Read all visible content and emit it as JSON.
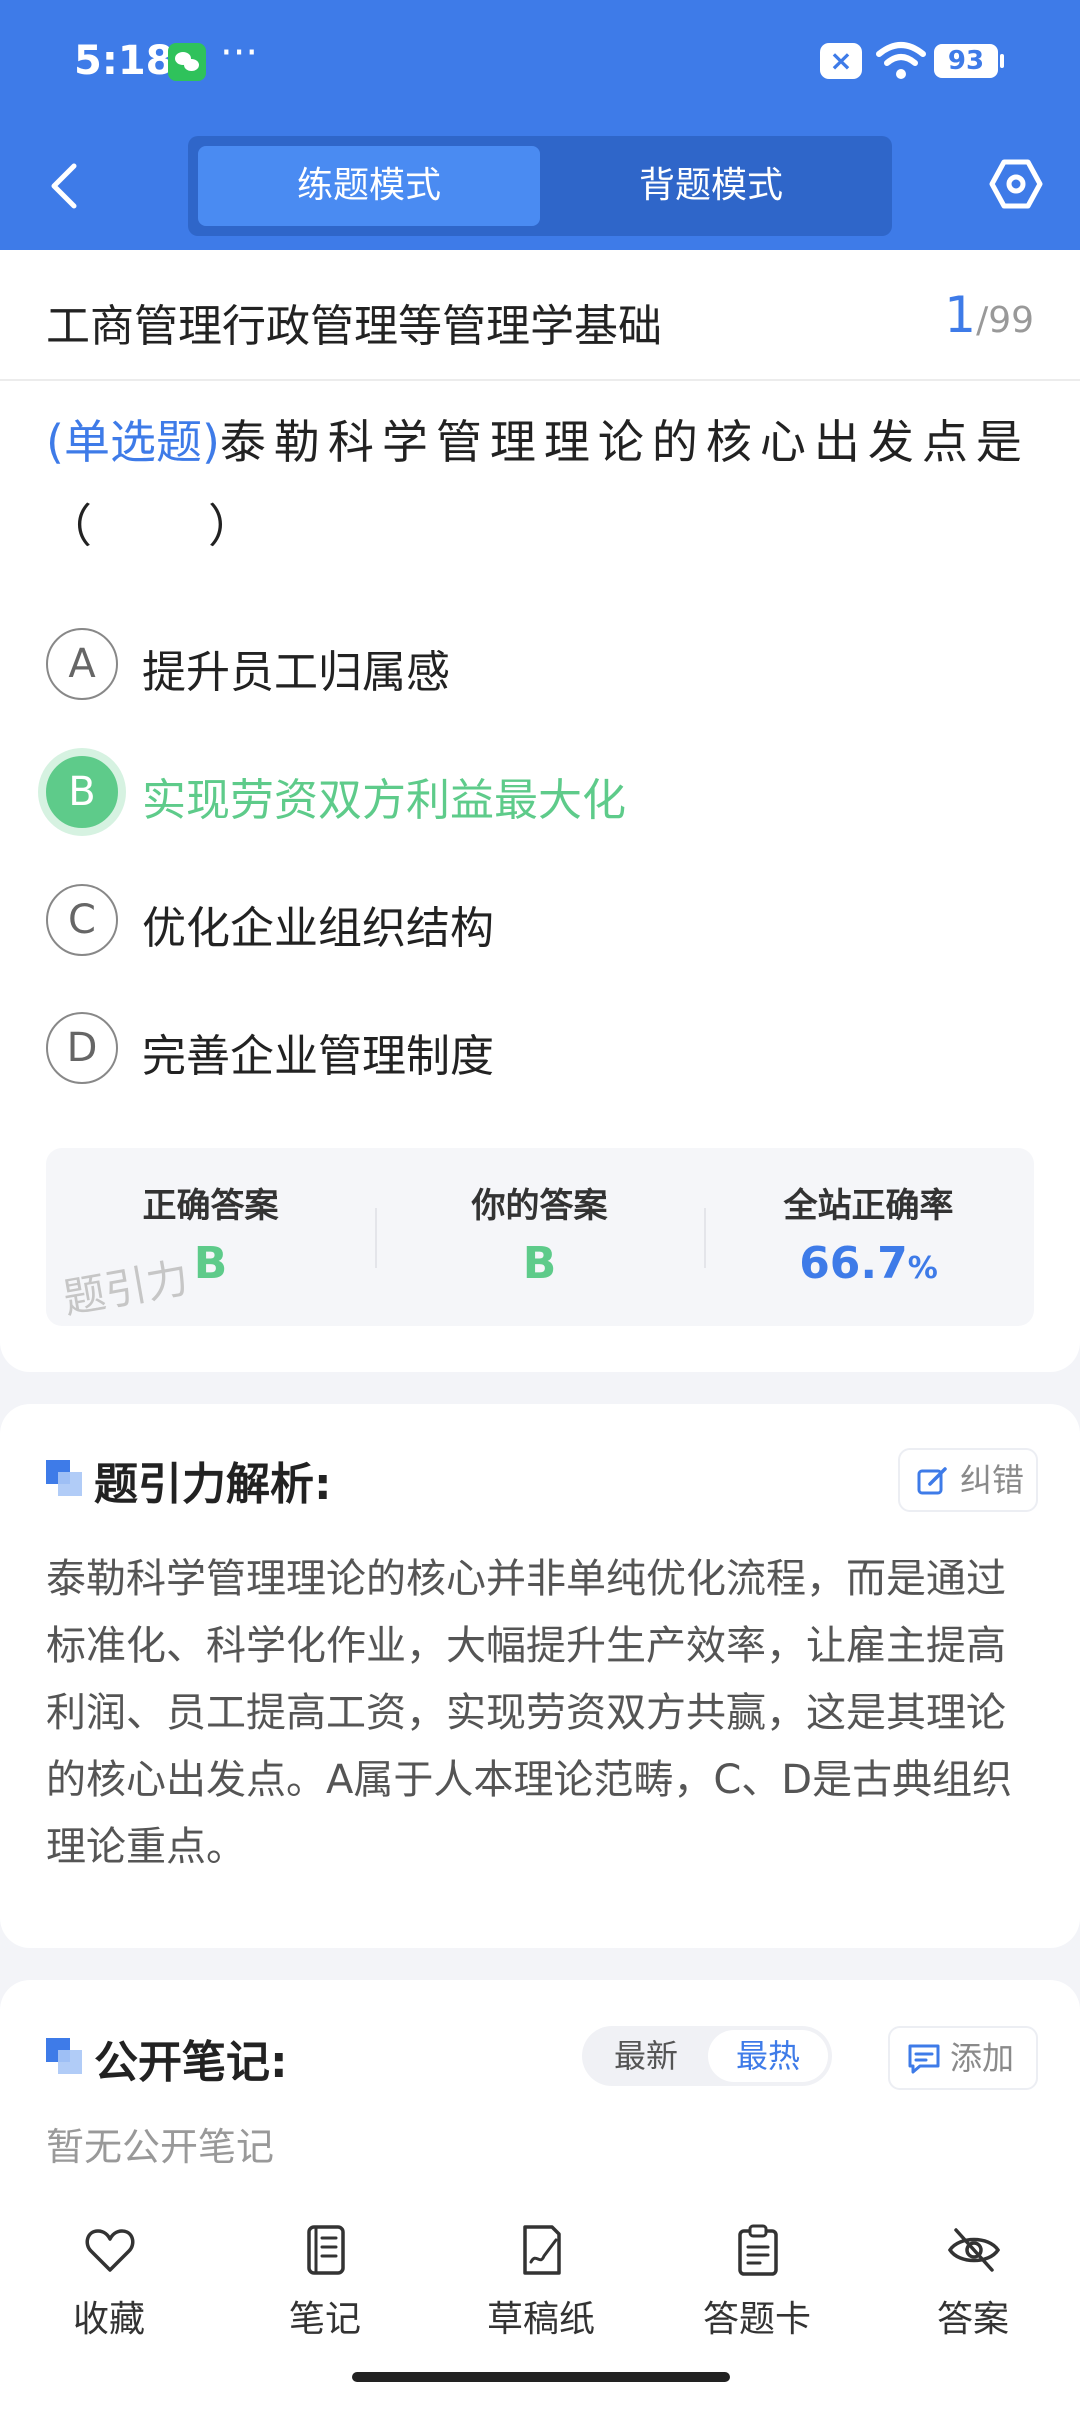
{
  "status_bar": {
    "time": "5:18",
    "dots": "···",
    "battery": "93"
  },
  "header": {
    "tabs": [
      {
        "label": "练题模式",
        "active": true
      },
      {
        "label": "背题模式",
        "active": false
      }
    ]
  },
  "subject": {
    "title": "工商管理行政管理等管理学基础",
    "current": "1",
    "total": "/99"
  },
  "question": {
    "type": "(单选题)",
    "text": "泰勒科学管理理论的核心出发点是（　　）"
  },
  "options": [
    {
      "letter": "A",
      "text": "提升员工归属感"
    },
    {
      "letter": "B",
      "text": "实现劳资双方利益最大化"
    },
    {
      "letter": "C",
      "text": "优化企业组织结构"
    },
    {
      "letter": "D",
      "text": "完善企业管理制度"
    }
  ],
  "selected_option": "B",
  "stats": {
    "correct_label": "正确答案",
    "correct_value": "B",
    "yours_label": "你的答案",
    "yours_value": "B",
    "rate_label": "全站正确率",
    "rate_value": "66.7",
    "rate_unit": "%"
  },
  "watermark": "题引力",
  "analysis": {
    "title": "题引力解析:",
    "report_label": "纠错",
    "text": "泰勒科学管理理论的核心并非单纯优化流程，而是通过标准化、科学化作业，大幅提升生产效率，让雇主提高利润、员工提高工资，实现劳资双方共赢，这是其理论的核心出发点。A属于人本理论范畴，C、D是古典组织理论重点。"
  },
  "notes": {
    "title": "公开笔记:",
    "sort_newest": "最新",
    "sort_hottest": "最热",
    "add_label": "添加",
    "empty_text": "暂无公开笔记"
  },
  "bottom_nav": [
    "收藏",
    "笔记",
    "草稿纸",
    "答题卡",
    "答案"
  ],
  "colors": {
    "primary": "#3e7be8",
    "correct": "#5ecb8a"
  }
}
